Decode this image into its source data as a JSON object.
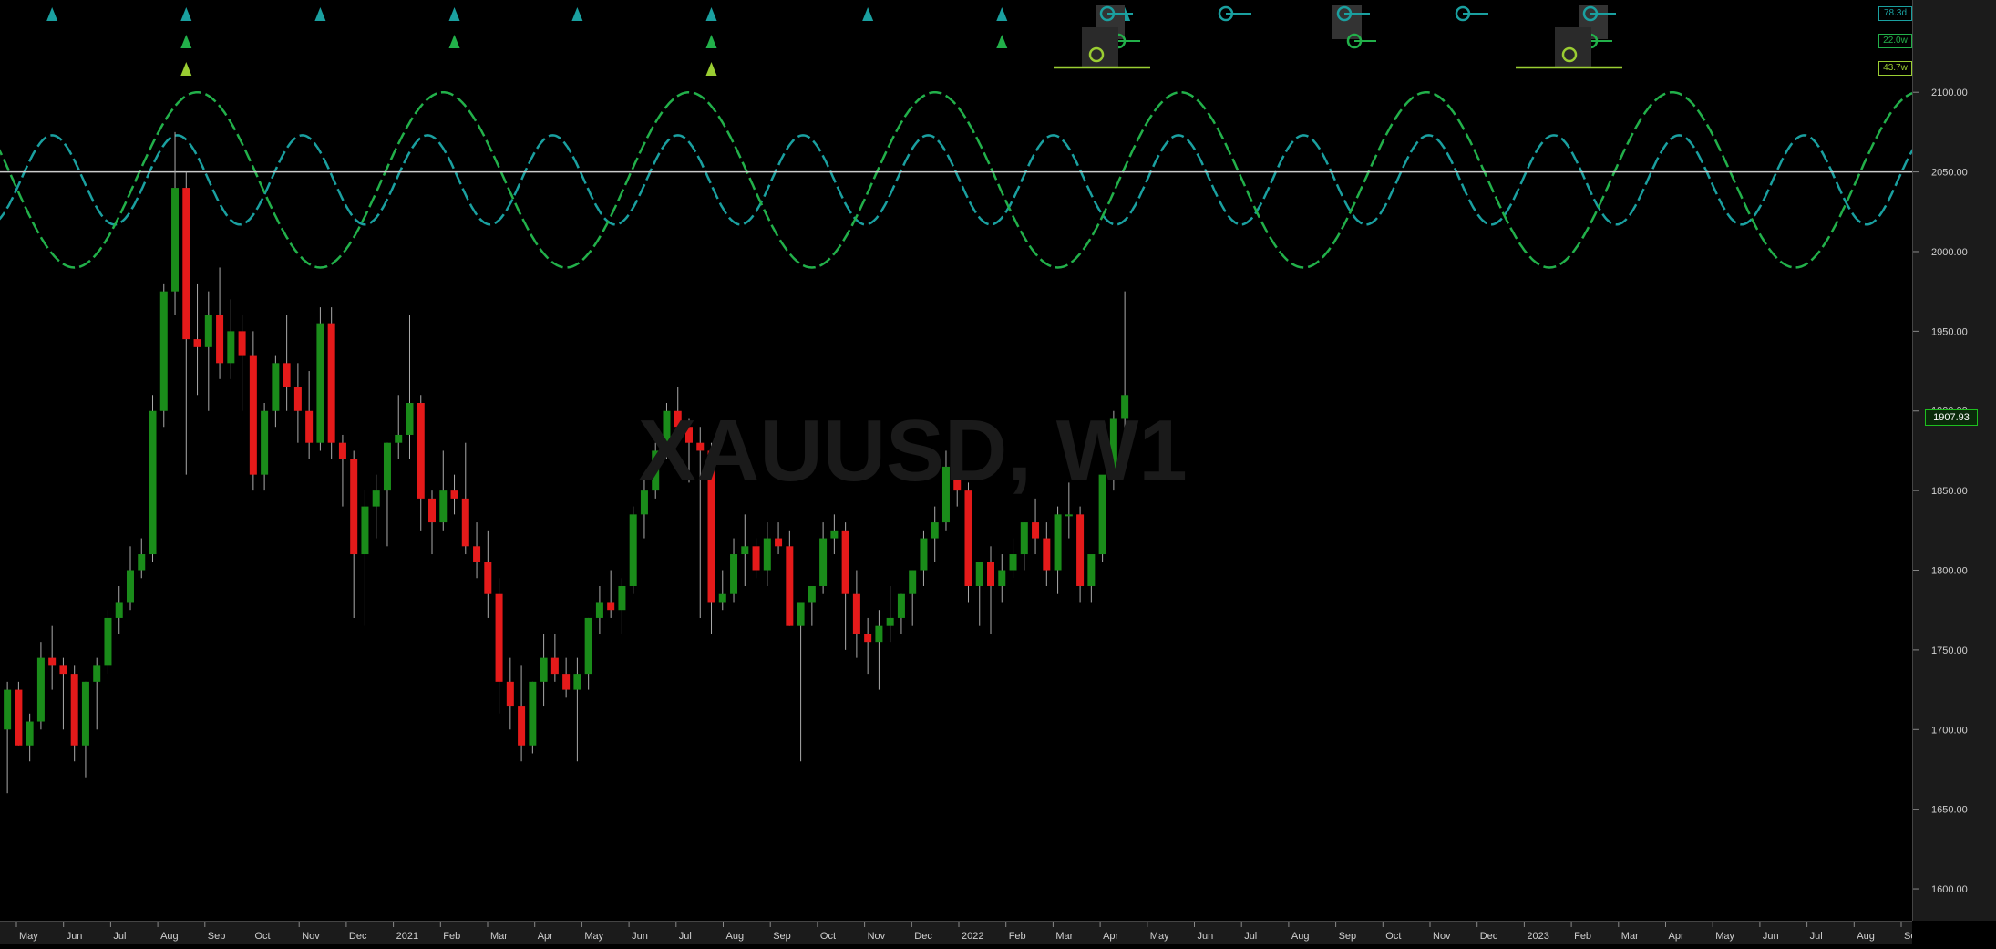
{
  "symbol_title": "XAUUSD, W1",
  "last_price": "1907.93",
  "cycle_labels": [
    {
      "text": "78.3d",
      "color": "#1aa0a0"
    },
    {
      "text": "22.0w",
      "color": "#22b04a"
    },
    {
      "text": "43.7w",
      "color": "#9acd32"
    }
  ],
  "colors": {
    "background": "#000000",
    "bull": "#1a8c1a",
    "bear": "#e51a1a",
    "wick": "#aaaaaa",
    "cycle_short": "#1aa0a0",
    "cycle_mid": "#22b04a",
    "cycle_long": "#9acd32",
    "baseline": "#cccccc"
  },
  "chart_data": {
    "type": "candlestick",
    "timeframe": "W1",
    "ylim": [
      1580,
      2115
    ],
    "y_ticks": [
      "1600.00",
      "1650.00",
      "1700.00",
      "1750.00",
      "1800.00",
      "1850.00",
      "1900.00",
      "1950.00",
      "2000.00",
      "2050.00",
      "2100.00"
    ],
    "x_tick_labels": [
      "May",
      "Jun",
      "Jul",
      "Aug",
      "Sep",
      "Oct",
      "Nov",
      "Dec",
      "2021",
      "Feb",
      "Mar",
      "Apr",
      "May",
      "Jun",
      "Jul",
      "Aug",
      "Sep",
      "Oct",
      "Nov",
      "Dec",
      "2022",
      "Feb",
      "Mar",
      "Apr",
      "May",
      "Jun",
      "Jul",
      "Aug",
      "Sep",
      "Oct",
      "Nov",
      "Dec",
      "2023",
      "Feb",
      "Mar",
      "Apr",
      "May",
      "Jun",
      "Jul",
      "Aug",
      "Sep"
    ],
    "candles": [
      [
        1700,
        1730,
        1660,
        1725
      ],
      [
        1725,
        1730,
        1690,
        1690
      ],
      [
        1690,
        1710,
        1680,
        1705
      ],
      [
        1705,
        1755,
        1700,
        1745
      ],
      [
        1745,
        1765,
        1725,
        1740
      ],
      [
        1740,
        1745,
        1700,
        1735
      ],
      [
        1735,
        1740,
        1680,
        1690
      ],
      [
        1690,
        1730,
        1670,
        1730
      ],
      [
        1730,
        1745,
        1700,
        1740
      ],
      [
        1740,
        1775,
        1735,
        1770
      ],
      [
        1770,
        1790,
        1760,
        1780
      ],
      [
        1780,
        1815,
        1775,
        1800
      ],
      [
        1800,
        1820,
        1795,
        1810
      ],
      [
        1810,
        1910,
        1805,
        1900
      ],
      [
        1900,
        1980,
        1890,
        1975
      ],
      [
        1975,
        2075,
        1960,
        2040
      ],
      [
        2040,
        2050,
        1860,
        1945
      ],
      [
        1945,
        1980,
        1910,
        1940
      ],
      [
        1940,
        1975,
        1900,
        1960
      ],
      [
        1960,
        1990,
        1920,
        1930
      ],
      [
        1930,
        1970,
        1920,
        1950
      ],
      [
        1950,
        1960,
        1900,
        1935
      ],
      [
        1935,
        1950,
        1850,
        1860
      ],
      [
        1860,
        1905,
        1850,
        1900
      ],
      [
        1900,
        1935,
        1890,
        1930
      ],
      [
        1930,
        1960,
        1900,
        1915
      ],
      [
        1915,
        1930,
        1880,
        1900
      ],
      [
        1900,
        1925,
        1870,
        1880
      ],
      [
        1880,
        1965,
        1875,
        1955
      ],
      [
        1955,
        1965,
        1870,
        1880
      ],
      [
        1880,
        1885,
        1840,
        1870
      ],
      [
        1870,
        1875,
        1770,
        1810
      ],
      [
        1810,
        1850,
        1765,
        1840
      ],
      [
        1840,
        1860,
        1820,
        1850
      ],
      [
        1850,
        1880,
        1815,
        1880
      ],
      [
        1880,
        1910,
        1870,
        1885
      ],
      [
        1885,
        1960,
        1870,
        1905
      ],
      [
        1905,
        1910,
        1825,
        1845
      ],
      [
        1845,
        1850,
        1810,
        1830
      ],
      [
        1830,
        1875,
        1825,
        1850
      ],
      [
        1850,
        1860,
        1835,
        1845
      ],
      [
        1845,
        1880,
        1810,
        1815
      ],
      [
        1815,
        1830,
        1795,
        1805
      ],
      [
        1805,
        1825,
        1770,
        1785
      ],
      [
        1785,
        1795,
        1710,
        1730
      ],
      [
        1730,
        1745,
        1700,
        1715
      ],
      [
        1715,
        1740,
        1680,
        1690
      ],
      [
        1690,
        1730,
        1685,
        1730
      ],
      [
        1730,
        1760,
        1715,
        1745
      ],
      [
        1745,
        1760,
        1730,
        1735
      ],
      [
        1735,
        1745,
        1720,
        1725
      ],
      [
        1725,
        1745,
        1680,
        1735
      ],
      [
        1735,
        1770,
        1725,
        1770
      ],
      [
        1770,
        1790,
        1760,
        1780
      ],
      [
        1780,
        1800,
        1770,
        1775
      ],
      [
        1775,
        1795,
        1760,
        1790
      ],
      [
        1790,
        1840,
        1785,
        1835
      ],
      [
        1835,
        1860,
        1820,
        1850
      ],
      [
        1850,
        1880,
        1845,
        1875
      ],
      [
        1875,
        1905,
        1870,
        1900
      ],
      [
        1900,
        1915,
        1885,
        1890
      ],
      [
        1890,
        1895,
        1855,
        1880
      ],
      [
        1880,
        1890,
        1770,
        1875
      ],
      [
        1875,
        1880,
        1760,
        1780
      ],
      [
        1780,
        1800,
        1775,
        1785
      ],
      [
        1785,
        1820,
        1780,
        1810
      ],
      [
        1810,
        1835,
        1790,
        1815
      ],
      [
        1815,
        1820,
        1795,
        1800
      ],
      [
        1800,
        1830,
        1790,
        1820
      ],
      [
        1820,
        1830,
        1810,
        1815
      ],
      [
        1815,
        1825,
        1765,
        1765
      ],
      [
        1765,
        1780,
        1680,
        1780
      ],
      [
        1780,
        1790,
        1765,
        1790
      ],
      [
        1790,
        1830,
        1785,
        1820
      ],
      [
        1820,
        1835,
        1810,
        1825
      ],
      [
        1825,
        1830,
        1750,
        1785
      ],
      [
        1785,
        1800,
        1745,
        1760
      ],
      [
        1760,
        1770,
        1735,
        1755
      ],
      [
        1755,
        1775,
        1725,
        1765
      ],
      [
        1765,
        1790,
        1755,
        1770
      ],
      [
        1770,
        1785,
        1760,
        1785
      ],
      [
        1785,
        1800,
        1765,
        1800
      ],
      [
        1800,
        1825,
        1790,
        1820
      ],
      [
        1820,
        1840,
        1805,
        1830
      ],
      [
        1830,
        1875,
        1825,
        1865
      ],
      [
        1865,
        1880,
        1840,
        1850
      ],
      [
        1850,
        1855,
        1780,
        1790
      ],
      [
        1790,
        1800,
        1765,
        1805
      ],
      [
        1805,
        1815,
        1760,
        1790
      ],
      [
        1790,
        1810,
        1780,
        1800
      ],
      [
        1800,
        1820,
        1795,
        1810
      ],
      [
        1810,
        1830,
        1800,
        1830
      ],
      [
        1830,
        1845,
        1810,
        1820
      ],
      [
        1820,
        1830,
        1790,
        1800
      ],
      [
        1800,
        1840,
        1785,
        1835
      ],
      [
        1835,
        1855,
        1820,
        1835
      ],
      [
        1835,
        1840,
        1780,
        1790
      ],
      [
        1790,
        1800,
        1780,
        1810
      ],
      [
        1810,
        1850,
        1805,
        1860
      ],
      [
        1860,
        1900,
        1850,
        1895
      ],
      [
        1895,
        1975,
        1885,
        1910
      ]
    ],
    "series": [
      {
        "name": "78.3d",
        "color": "#1aa0a0",
        "center": 2045,
        "amplitude": 28,
        "period_weeks": 11.2,
        "phase_week": 4
      },
      {
        "name": "22.0w",
        "color": "#22b04a",
        "center": 2045,
        "amplitude": 55,
        "period_weeks": 22,
        "phase_week": 17
      }
    ],
    "baseline": 2050,
    "grid": false
  },
  "cycle_markers": {
    "short_triangles": [
      4,
      16,
      28,
      40,
      51,
      63,
      77,
      89,
      100
    ],
    "mid_triangles": [
      16,
      40,
      63,
      89
    ],
    "long_triangles": [
      16,
      63
    ]
  }
}
